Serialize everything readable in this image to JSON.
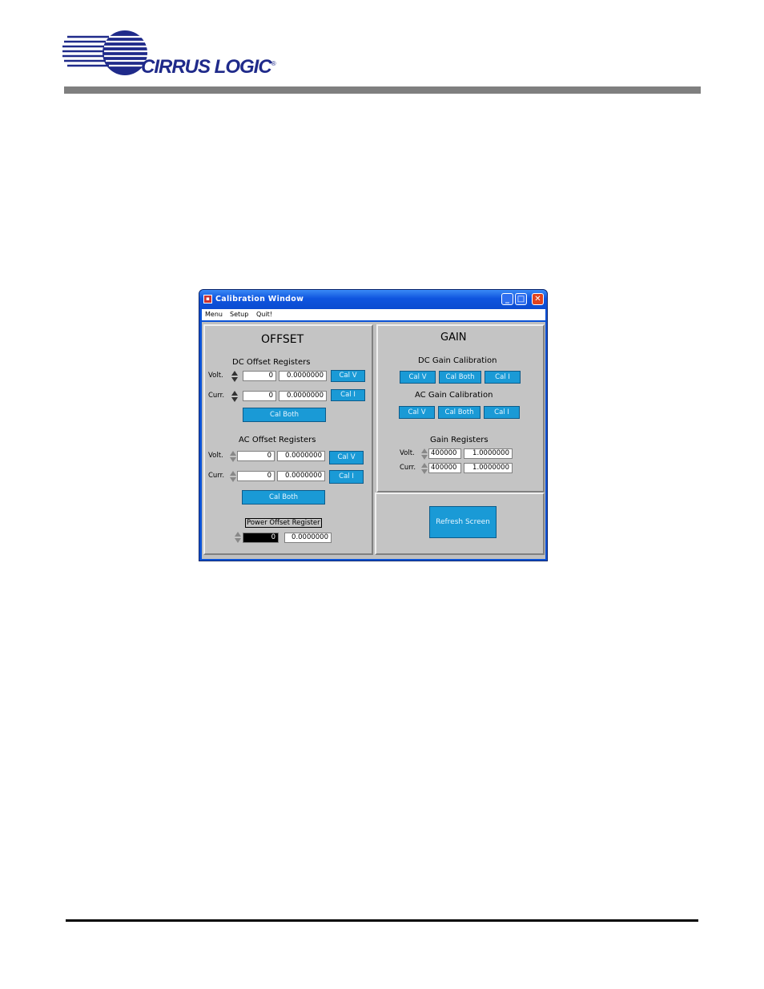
{
  "header": {
    "brand_name": "CIRRUS LOGIC",
    "brand_reg": "®"
  },
  "window": {
    "title": "Calibration Window",
    "menu": [
      "Menu",
      "Setup",
      "Quit!"
    ],
    "controls": {
      "minimize": "_",
      "maximize": "□",
      "close": "✕"
    }
  },
  "offset": {
    "title": "OFFSET",
    "dc": {
      "heading": "DC Offset Registers",
      "volt_label": "Volt.",
      "curr_label": "Curr.",
      "volt_reg": "0",
      "volt_val": "0.0000000",
      "curr_reg": "0",
      "curr_val": "0.0000000",
      "cal_v": "Cal V",
      "cal_i": "Cal I",
      "cal_both": "Cal Both"
    },
    "ac": {
      "heading": "AC Offset Registers",
      "volt_label": "Volt.",
      "curr_label": "Curr.",
      "volt_reg": "0",
      "volt_val": "0.0000000",
      "curr_reg": "0",
      "curr_val": "0.0000000",
      "cal_v": "Cal V",
      "cal_i": "Cal I",
      "cal_both": "Cal Both"
    },
    "power": {
      "heading": "Power Offset Register",
      "reg": "0",
      "val": "0.0000000"
    }
  },
  "gain": {
    "title": "GAIN",
    "dc_heading": "DC Gain Calibration",
    "ac_heading": "AC Gain Calibration",
    "cal_v": "Cal V",
    "cal_both": "Cal Both",
    "cal_i": "Cal I",
    "registers_heading": "Gain Registers",
    "volt_label": "Volt.",
    "curr_label": "Curr.",
    "volt_reg": "400000",
    "volt_val": "1.0000000",
    "curr_reg": "400000",
    "curr_val": "1.0000000"
  },
  "refresh_label": "Refresh Screen"
}
